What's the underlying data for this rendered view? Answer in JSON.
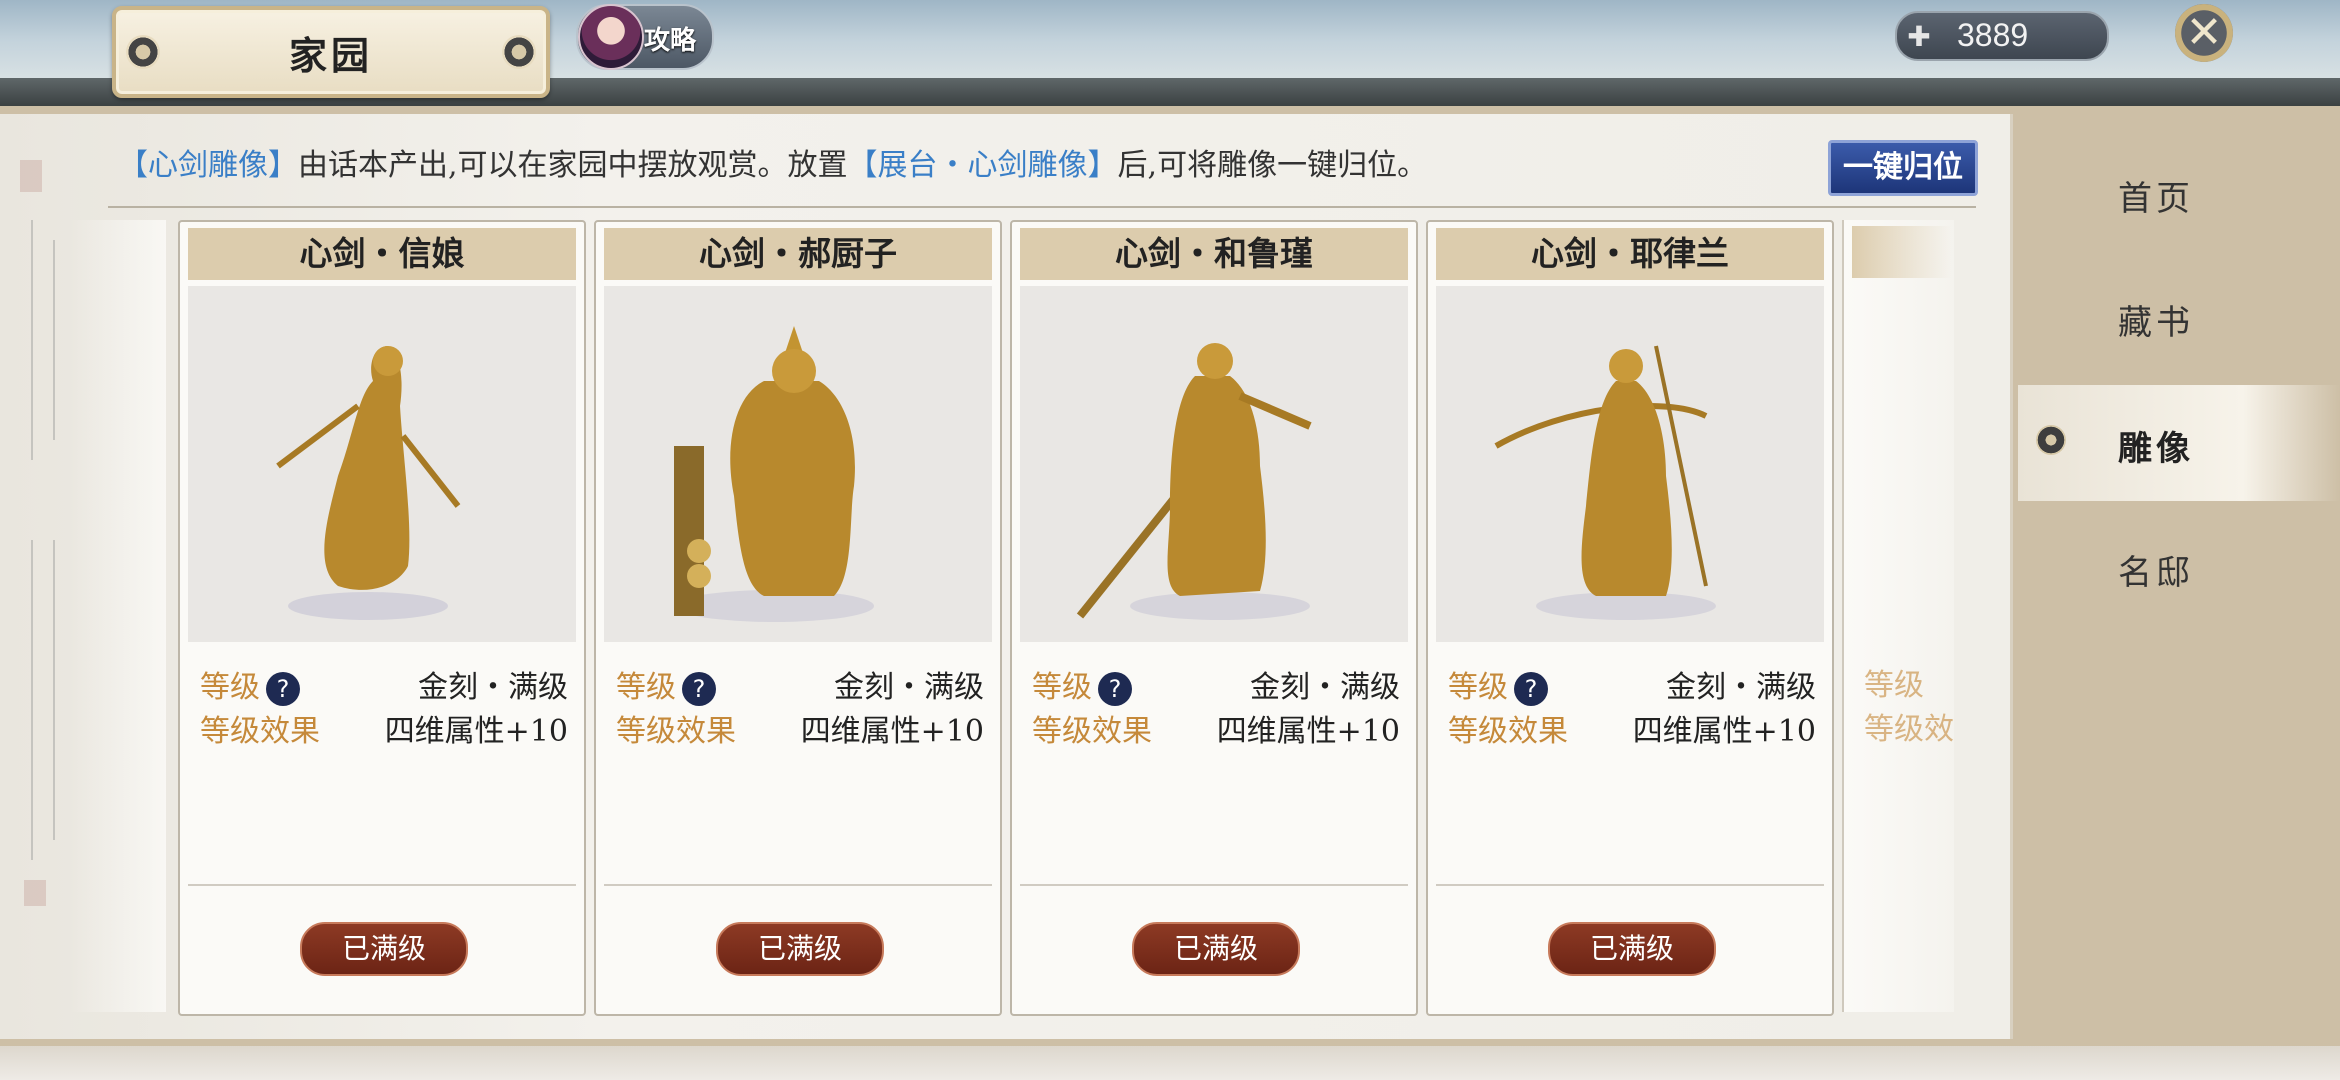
{
  "header": {
    "title": "家园",
    "strategy_label": "攻略",
    "currency_value": "3889",
    "currency_icon": "add-currency-icon",
    "close_icon": "close-icon"
  },
  "notice": {
    "part1": "【心剑雕像】",
    "part2": "由话本产出,可以在家园中摆放观赏。放置",
    "part3": "【展台・心剑雕像】",
    "part4": "后,可将雕像一键归位。",
    "highlight_color": "#3a7fc7"
  },
  "return_button": "一键归位",
  "cards": [
    {
      "title": "心剑・信娘",
      "level_label": "等级",
      "level_value": "金刻・满级",
      "effect_label": "等级效果",
      "effect_value": "四维属性+10",
      "button": "已满级"
    },
    {
      "title": "心剑・郝厨子",
      "level_label": "等级",
      "level_value": "金刻・满级",
      "effect_label": "等级效果",
      "effect_value": "四维属性+10",
      "button": "已满级"
    },
    {
      "title": "心剑・和鲁瑾",
      "level_label": "等级",
      "level_value": "金刻・满级",
      "effect_label": "等级效果",
      "effect_value": "四维属性+10",
      "button": "已满级"
    },
    {
      "title": "心剑・耶律兰",
      "level_label": "等级",
      "level_value": "金刻・满级",
      "effect_label": "等级效果",
      "effect_value": "四维属性+10",
      "button": "已满级"
    }
  ],
  "partial_card": {
    "row1": "等级",
    "row2": "等级效"
  },
  "help_glyph": "?",
  "nav": [
    {
      "label": "首页"
    },
    {
      "label": "藏书"
    },
    {
      "label": "雕像",
      "active": true
    },
    {
      "label": "名邸"
    }
  ],
  "colors": {
    "accent_gold": "#c5893a",
    "button_red": "#7a2c1b",
    "return_blue": "#1d3579"
  }
}
